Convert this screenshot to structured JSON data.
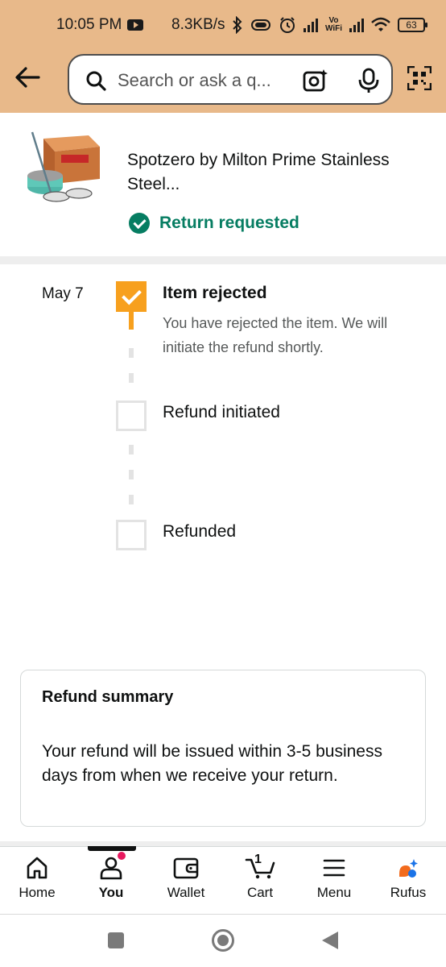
{
  "status_bar": {
    "time": "10:05 PM",
    "network_speed": "8.3KB/s",
    "vowifi_label_top": "Vo",
    "vowifi_label_bottom": "WiFi",
    "battery_level": "63"
  },
  "search": {
    "placeholder": "Search or ask a q..."
  },
  "product": {
    "title": "Spotzero by Milton Prime Stainless Steel...",
    "status": "Return requested",
    "status_color": "#067d62"
  },
  "timeline": {
    "steps": [
      {
        "date": "May 7",
        "title": "Item rejected",
        "description": "You have rejected the item. We will initiate the refund shortly.",
        "completed": true
      },
      {
        "date": "",
        "title": "Refund initiated",
        "description": "",
        "completed": false
      },
      {
        "date": "",
        "title": "Refunded",
        "description": "",
        "completed": false
      }
    ],
    "accent_color": "#f7a01e"
  },
  "refund_summary": {
    "title": "Refund summary",
    "text": "Your refund will be issued within 3-5 business days from when we receive your return."
  },
  "bottom_nav": {
    "items": [
      {
        "label": "Home",
        "icon": "home-icon",
        "active": false
      },
      {
        "label": "You",
        "icon": "user-icon",
        "active": true
      },
      {
        "label": "Wallet",
        "icon": "wallet-icon",
        "active": false
      },
      {
        "label": "Cart",
        "icon": "cart-icon",
        "active": false,
        "count": "1"
      },
      {
        "label": "Menu",
        "icon": "menu-icon",
        "active": false
      },
      {
        "label": "Rufus",
        "icon": "rufus-icon",
        "active": false
      }
    ]
  }
}
